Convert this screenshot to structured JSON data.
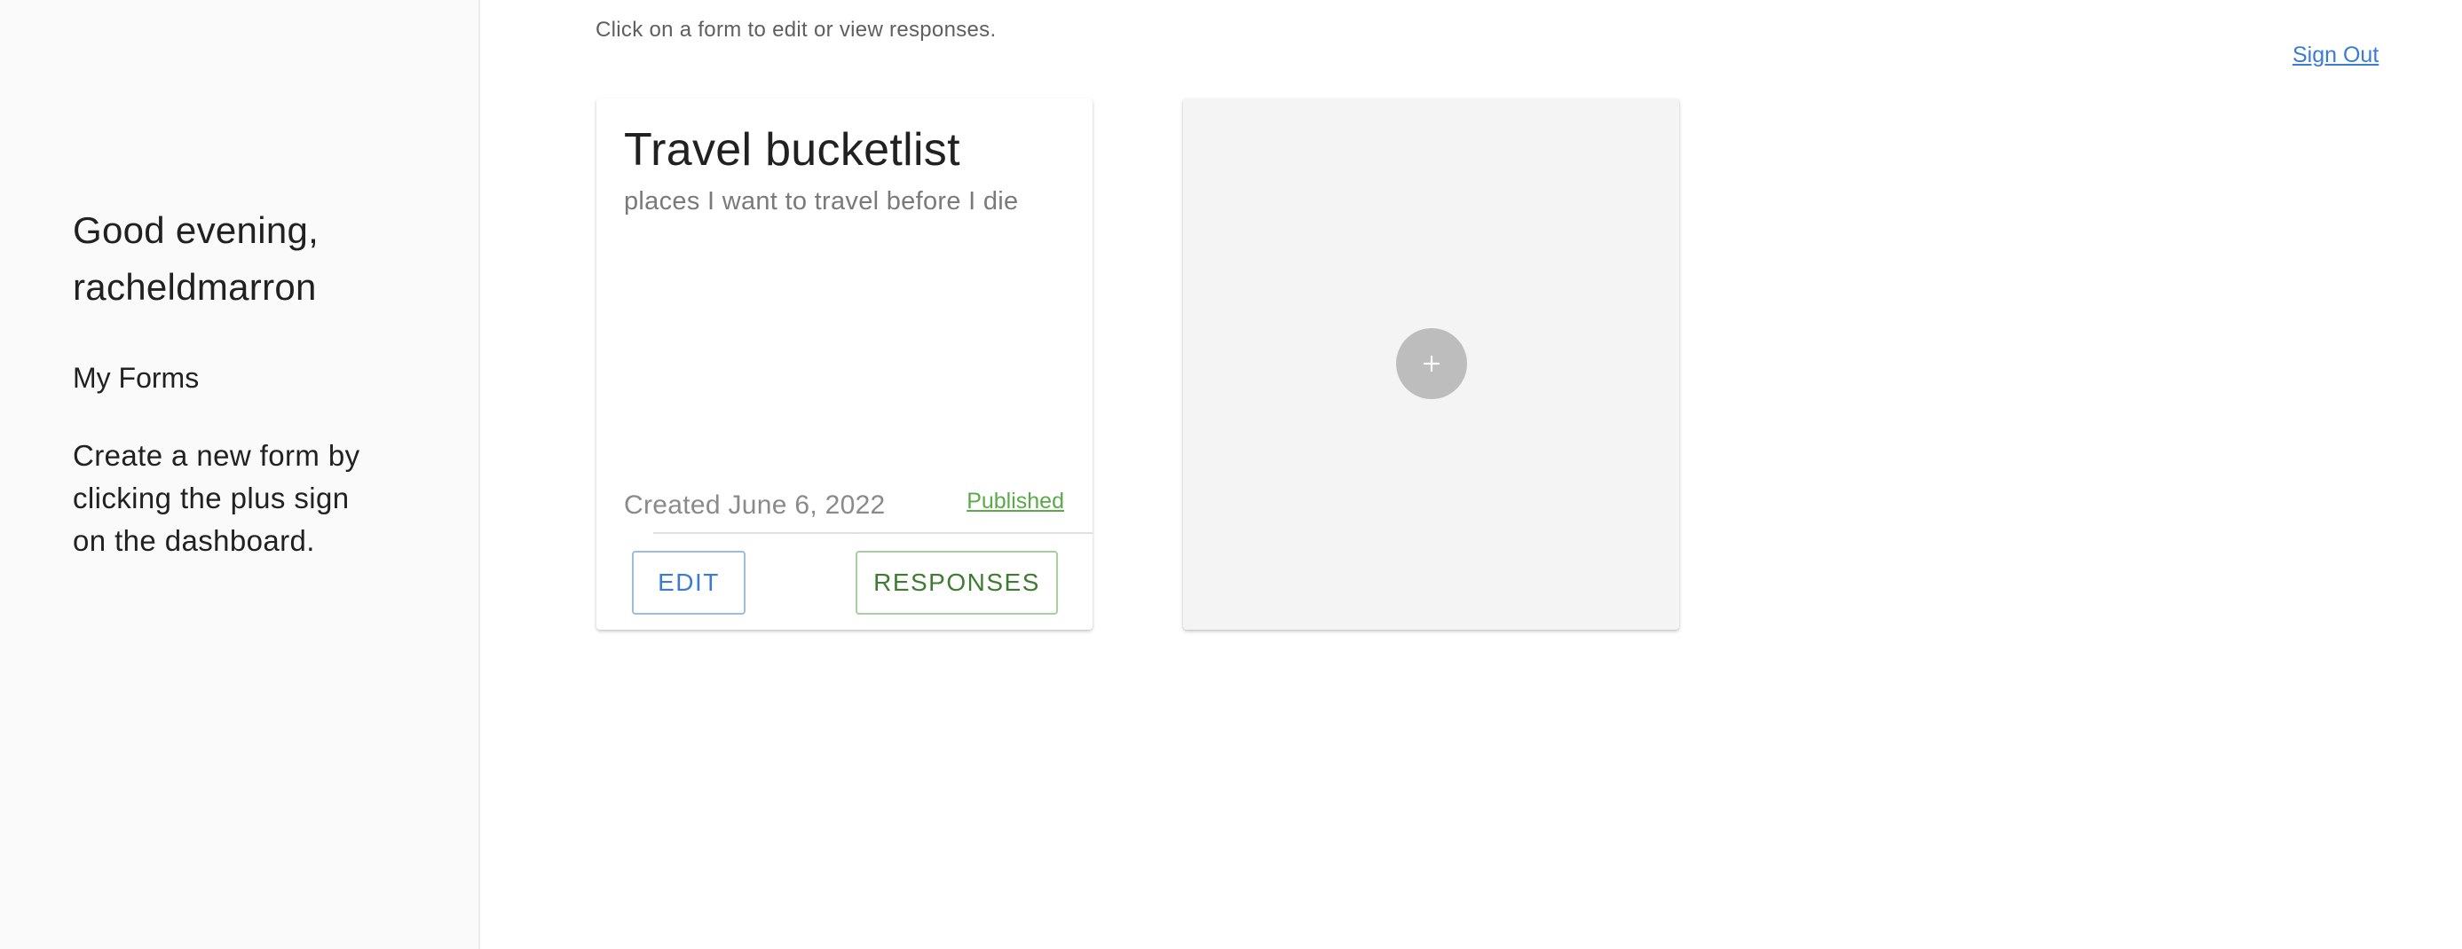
{
  "sidebar": {
    "greeting": "Good evening, racheldmarron",
    "section_title": "My Forms",
    "help_text": "Create a new form by clicking the plus sign on the dashboard."
  },
  "main": {
    "instructions": "Click on a form to edit or view responses.",
    "sign_out_label": "Sign Out",
    "forms": [
      {
        "title": "Travel bucketlist",
        "description": "places I want to travel before I die",
        "created": "Created June 6, 2022",
        "status": "Published",
        "edit_label": "EDIT",
        "responses_label": "RESPONSES"
      }
    ],
    "new_form": {
      "icon": "plus-icon"
    }
  },
  "colors": {
    "link_blue": "#3a7bd5",
    "published_green": "#5aaa4a",
    "responses_green": "#3f7c32",
    "sidebar_bg": "#fafafa",
    "new_card_bg": "#f4f4f4",
    "add_button_bg": "#bdbdbd"
  }
}
